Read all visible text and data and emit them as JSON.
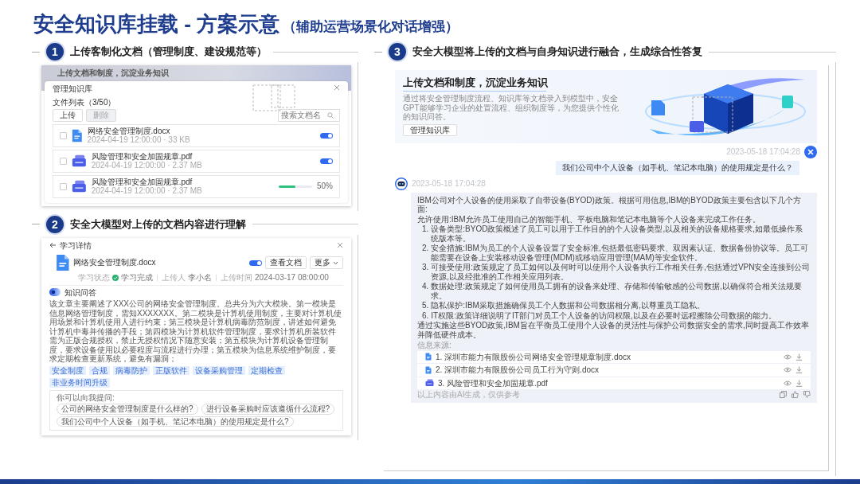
{
  "title": {
    "main": "安全知识库挂载 - 方案示意",
    "sub": "（辅助运营场景化对话增强）"
  },
  "steps": [
    {
      "kind": "upload",
      "number": "1",
      "heading": "上传客制化文档（管理制度、建设规范等）",
      "backdrop_title": "上传文档和制度，沉淀业务知识",
      "dialog": {
        "title": "管理知识库",
        "list_label": "文件列表（3/50）",
        "buttons": [
          {
            "label": "上传",
            "disabled": false
          },
          {
            "label": "删除",
            "disabled": true
          }
        ],
        "search": {
          "placeholder": "搜索文档名"
        },
        "files": [
          {
            "kind": "word",
            "name": "网络安全管理制度.docx",
            "meta": "2024-04-19 12:00:00 · 33 KB",
            "checked": false,
            "enabled": true
          },
          {
            "kind": "pdf",
            "name": "风险管理和安全加固规章.pdf",
            "meta": "2024-04-19 12:00:00 · 2.37 MB",
            "checked": false,
            "enabled": true
          },
          {
            "kind": "pdf",
            "name": "风险管理和安全加固规章.pdf",
            "meta": "2024-04-19 12:00:00 · 2.37 MB",
            "checked": false,
            "level": 0.5,
            "reading": "50%"
          }
        ]
      }
    },
    {
      "kind": "detail",
      "number": "2",
      "heading": "安全大模型对上传的文档内容进行理解",
      "back_label": "学习详情",
      "document": {
        "kind": "word",
        "name": "网络安全管理制度.docx",
        "enabled": true,
        "fields": [
          {
            "kind": "status",
            "label": "学习状态",
            "value": "学习完成"
          },
          {
            "kind": "text",
            "label": "上传人",
            "value": "李小名"
          },
          {
            "kind": "text",
            "label": "上传时间",
            "value": "2024-03-17 08:00:00"
          }
        ],
        "buttons": [
          {
            "kind": "plain",
            "label": "查看文档"
          },
          {
            "kind": "menu",
            "label": "更多"
          }
        ]
      },
      "section_title": "知识问答",
      "summary": "该文章主要阐述了XXX公司的网络安全管理制度。总共分为六大模块。第一模块是信息网络管理制度，需知XXXXXXX。第二模块是计算机使用制度，主要对计算机使用场景和计算机使用人进行约束；第三模块是计算机病毒防范制度，讲述如何避免计算机中毒并传播的手段；第四模块为计算机软件管理制度，要求计算机所装软件需为正版合规授权，禁止无授权情况下随意安装；第五模块为计算机设备管理制度，要求设备使用以必要程度与流程进行办理；第五模块为信息系统维护制度，要求定期检查更新系统，避免有漏洞；",
      "tags": [
        "安全制度",
        "合规",
        "病毒防护",
        "正版软件",
        "设备采购管理",
        "定期检查",
        "非业务时间升级"
      ],
      "suggest_title": "你可以向我提问:",
      "questions": [
        "公司的网络安全管理制度是什么样的?",
        "进行设备采购时应该遵循什么流程?",
        "我们公司中个人设备（如手机、笔记本电脑）的使用规定是什么?"
      ]
    },
    {
      "kind": "chat",
      "number": "3",
      "heading": "安全大模型将上传的文档与自身知识进行融合，生成综合性答复",
      "banner": {
        "title": "上传文档和制度，沉淀业务知识",
        "text": "通过将安全管理制度流程、知识库等文档录入到模型中，安全GPT能够学习企业的处置流程、组织制度等，为您提供个性化的知识问答。",
        "button": "管理知识库"
      },
      "messages": [
        {
          "kind": "user",
          "time": "2023-05-18 17:04:28",
          "text": "我们公司中个人设备（如手机、笔记本电脑）的使用规定是什么？"
        },
        {
          "kind": "assistant",
          "time": "2023-05-18 17:04:28",
          "intro": [
            "IBM公司对个人设备的使用采取了自带设备(BYOD)政策。根据可用信息,IBM的BYOD政策主要包含以下几个方面:",
            "允许使用:IBM允许员工使用自己的智能手机、平板电脑和笔记本电脑等个人设备来完成工作任务。"
          ],
          "items": [
            {
              "number": "1.",
              "text": "设备类型:BYOD政策概述了员工可以用于工作目的的个人设备类型,以及相关的设备规格要求,如最低操作系统版本等。"
            },
            {
              "number": "2.",
              "text": "安全措施:IBM为员工的个人设备设置了安全标准,包括最低密码要求、双因素认证、数据备份协议等。员工可能需要在设备上安装移动设备管理(MDM)或移动应用管理(MAM)等安全软件。"
            },
            {
              "number": "3.",
              "text": "可接受使用:政策规定了员工如何以及何时可以使用个人设备执行工作相关任务,包括通过VPN安全连接到公司资源,以及经批准的工作相关应用列表。"
            },
            {
              "number": "4.",
              "text": "数据处理:政策规定了如何使用员工拥有的设备来处理、存储和传输敏感的公司数据,以确保符合相关法规要求。"
            },
            {
              "number": "5.",
              "text": "隐私保护:IBM采取措施确保员工个人数据和公司数据相分离,以尊重员工隐私。"
            },
            {
              "number": "6.",
              "text": "IT权限:政策详细说明了IT部门对员工个人设备的访问权限,以及在必要时远程擦除公司数据的能力。"
            }
          ],
          "closing": "通过实施这些BYOD政策,IBM旨在平衡员工使用个人设备的灵活性与保护公司数据安全的需求,同时提高工作效率并降低硬件成本。",
          "sources_label": "信息来源:",
          "sources": [
            {
              "kind": "word",
              "name": "1. 深圳市能力有限股份公司网络安全管理规章制度.docx"
            },
            {
              "kind": "word",
              "name": "2. 深圳市能力有限股份公司员工行为守则.docx"
            },
            {
              "kind": "pdf",
              "name": "3. 风险管理和安全加固规章.pdf"
            }
          ],
          "note": "以上内容由AI生成，仅供参考"
        }
      ]
    }
  ]
}
